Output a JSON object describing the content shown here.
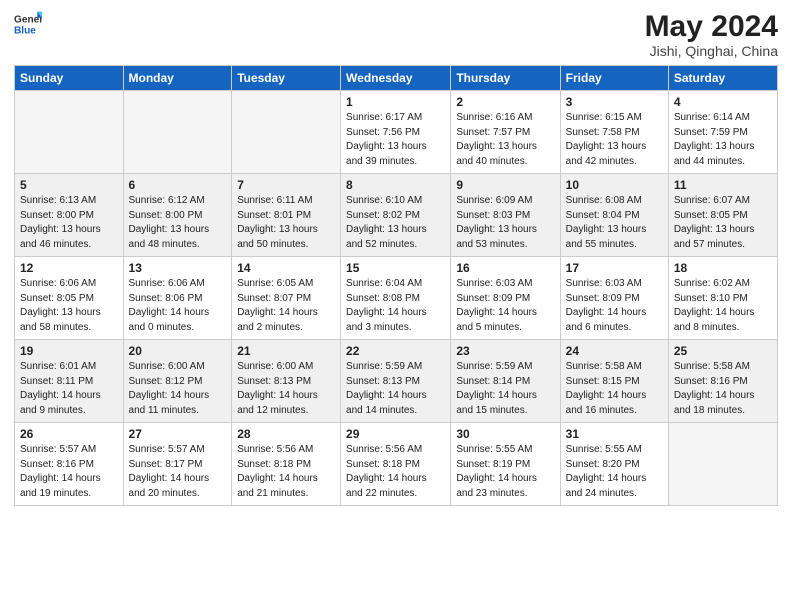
{
  "header": {
    "logo_general": "General",
    "logo_blue": "Blue",
    "month_title": "May 2024",
    "location": "Jishi, Qinghai, China"
  },
  "days_of_week": [
    "Sunday",
    "Monday",
    "Tuesday",
    "Wednesday",
    "Thursday",
    "Friday",
    "Saturday"
  ],
  "weeks": [
    [
      {
        "num": "",
        "info": ""
      },
      {
        "num": "",
        "info": ""
      },
      {
        "num": "",
        "info": ""
      },
      {
        "num": "1",
        "info": "Sunrise: 6:17 AM\nSunset: 7:56 PM\nDaylight: 13 hours\nand 39 minutes."
      },
      {
        "num": "2",
        "info": "Sunrise: 6:16 AM\nSunset: 7:57 PM\nDaylight: 13 hours\nand 40 minutes."
      },
      {
        "num": "3",
        "info": "Sunrise: 6:15 AM\nSunset: 7:58 PM\nDaylight: 13 hours\nand 42 minutes."
      },
      {
        "num": "4",
        "info": "Sunrise: 6:14 AM\nSunset: 7:59 PM\nDaylight: 13 hours\nand 44 minutes."
      }
    ],
    [
      {
        "num": "5",
        "info": "Sunrise: 6:13 AM\nSunset: 8:00 PM\nDaylight: 13 hours\nand 46 minutes."
      },
      {
        "num": "6",
        "info": "Sunrise: 6:12 AM\nSunset: 8:00 PM\nDaylight: 13 hours\nand 48 minutes."
      },
      {
        "num": "7",
        "info": "Sunrise: 6:11 AM\nSunset: 8:01 PM\nDaylight: 13 hours\nand 50 minutes."
      },
      {
        "num": "8",
        "info": "Sunrise: 6:10 AM\nSunset: 8:02 PM\nDaylight: 13 hours\nand 52 minutes."
      },
      {
        "num": "9",
        "info": "Sunrise: 6:09 AM\nSunset: 8:03 PM\nDaylight: 13 hours\nand 53 minutes."
      },
      {
        "num": "10",
        "info": "Sunrise: 6:08 AM\nSunset: 8:04 PM\nDaylight: 13 hours\nand 55 minutes."
      },
      {
        "num": "11",
        "info": "Sunrise: 6:07 AM\nSunset: 8:05 PM\nDaylight: 13 hours\nand 57 minutes."
      }
    ],
    [
      {
        "num": "12",
        "info": "Sunrise: 6:06 AM\nSunset: 8:05 PM\nDaylight: 13 hours\nand 58 minutes."
      },
      {
        "num": "13",
        "info": "Sunrise: 6:06 AM\nSunset: 8:06 PM\nDaylight: 14 hours\nand 0 minutes."
      },
      {
        "num": "14",
        "info": "Sunrise: 6:05 AM\nSunset: 8:07 PM\nDaylight: 14 hours\nand 2 minutes."
      },
      {
        "num": "15",
        "info": "Sunrise: 6:04 AM\nSunset: 8:08 PM\nDaylight: 14 hours\nand 3 minutes."
      },
      {
        "num": "16",
        "info": "Sunrise: 6:03 AM\nSunset: 8:09 PM\nDaylight: 14 hours\nand 5 minutes."
      },
      {
        "num": "17",
        "info": "Sunrise: 6:03 AM\nSunset: 8:09 PM\nDaylight: 14 hours\nand 6 minutes."
      },
      {
        "num": "18",
        "info": "Sunrise: 6:02 AM\nSunset: 8:10 PM\nDaylight: 14 hours\nand 8 minutes."
      }
    ],
    [
      {
        "num": "19",
        "info": "Sunrise: 6:01 AM\nSunset: 8:11 PM\nDaylight: 14 hours\nand 9 minutes."
      },
      {
        "num": "20",
        "info": "Sunrise: 6:00 AM\nSunset: 8:12 PM\nDaylight: 14 hours\nand 11 minutes."
      },
      {
        "num": "21",
        "info": "Sunrise: 6:00 AM\nSunset: 8:13 PM\nDaylight: 14 hours\nand 12 minutes."
      },
      {
        "num": "22",
        "info": "Sunrise: 5:59 AM\nSunset: 8:13 PM\nDaylight: 14 hours\nand 14 minutes."
      },
      {
        "num": "23",
        "info": "Sunrise: 5:59 AM\nSunset: 8:14 PM\nDaylight: 14 hours\nand 15 minutes."
      },
      {
        "num": "24",
        "info": "Sunrise: 5:58 AM\nSunset: 8:15 PM\nDaylight: 14 hours\nand 16 minutes."
      },
      {
        "num": "25",
        "info": "Sunrise: 5:58 AM\nSunset: 8:16 PM\nDaylight: 14 hours\nand 18 minutes."
      }
    ],
    [
      {
        "num": "26",
        "info": "Sunrise: 5:57 AM\nSunset: 8:16 PM\nDaylight: 14 hours\nand 19 minutes."
      },
      {
        "num": "27",
        "info": "Sunrise: 5:57 AM\nSunset: 8:17 PM\nDaylight: 14 hours\nand 20 minutes."
      },
      {
        "num": "28",
        "info": "Sunrise: 5:56 AM\nSunset: 8:18 PM\nDaylight: 14 hours\nand 21 minutes."
      },
      {
        "num": "29",
        "info": "Sunrise: 5:56 AM\nSunset: 8:18 PM\nDaylight: 14 hours\nand 22 minutes."
      },
      {
        "num": "30",
        "info": "Sunrise: 5:55 AM\nSunset: 8:19 PM\nDaylight: 14 hours\nand 23 minutes."
      },
      {
        "num": "31",
        "info": "Sunrise: 5:55 AM\nSunset: 8:20 PM\nDaylight: 14 hours\nand 24 minutes."
      },
      {
        "num": "",
        "info": ""
      }
    ]
  ]
}
